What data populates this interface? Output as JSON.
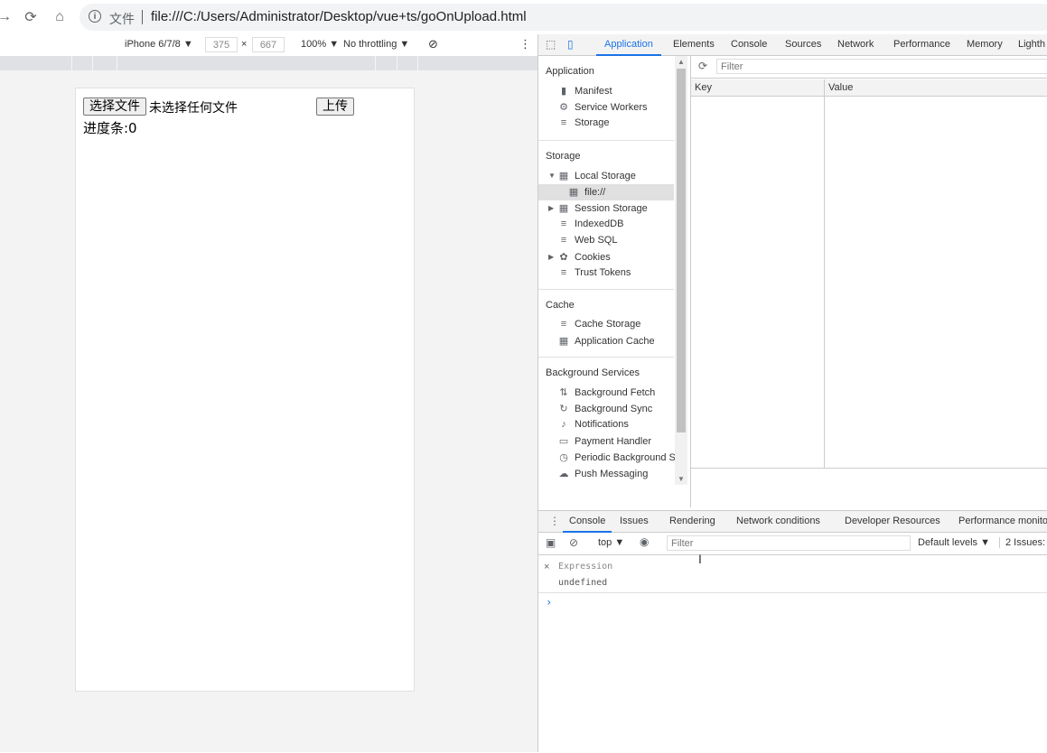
{
  "browser": {
    "url_scheme": "文件",
    "url": "file:///C:/Users/Administrator/Desktop/vue+ts/goOnUpload.html"
  },
  "device_toolbar": {
    "device": "iPhone 6/7/8 ▼",
    "width": "375",
    "x": "×",
    "height": "667",
    "zoom": "100% ▼",
    "throttle": "No throttling ▼"
  },
  "page": {
    "choose_file": "选择文件",
    "no_file": "未选择任何文件",
    "upload": "上传",
    "progress": "进度条:0"
  },
  "devtools": {
    "tabs": [
      "Application",
      "Elements",
      "Console",
      "Sources",
      "Network",
      "Performance",
      "Memory",
      "Lighth"
    ],
    "sidebar": {
      "app_header": "Application",
      "manifest": "Manifest",
      "service_workers": "Service Workers",
      "storage_item": "Storage",
      "storage_header": "Storage",
      "local_storage": "Local Storage",
      "file_origin": "file://",
      "session_storage": "Session Storage",
      "indexeddb": "IndexedDB",
      "websql": "Web SQL",
      "cookies": "Cookies",
      "trust_tokens": "Trust Tokens",
      "cache_header": "Cache",
      "cache_storage": "Cache Storage",
      "app_cache": "Application Cache",
      "bg_header": "Background Services",
      "bg_fetch": "Background Fetch",
      "bg_sync": "Background Sync",
      "notifications": "Notifications",
      "payment_handler": "Payment Handler",
      "periodic_bg": "Periodic Background Sy",
      "push_messaging": "Push Messaging"
    },
    "filter_placeholder": "Filter",
    "table": {
      "key": "Key",
      "value": "Value"
    },
    "drawer_tabs": [
      "Console",
      "Issues",
      "Rendering",
      "Network conditions",
      "Developer Resources",
      "Performance monito"
    ],
    "console": {
      "context": "top ▼",
      "filter": "Filter",
      "levels": "Default levels ▼",
      "issues": "2 Issues:",
      "expression": "Expression",
      "result": "undefined",
      "prompt": "›"
    }
  }
}
